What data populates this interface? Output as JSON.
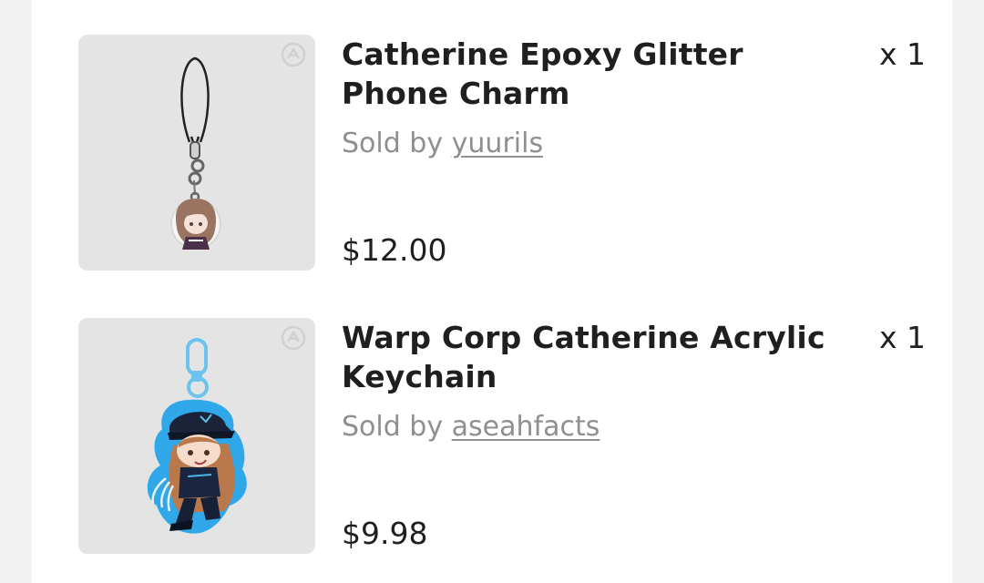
{
  "cart": {
    "items": [
      {
        "title": "Catherine Epoxy Glitter Phone Charm",
        "quantity": "x 1",
        "sold_by_prefix": "Sold by",
        "seller": "yuurils",
        "price": "$12.00",
        "image_icon": "phone-charm-image"
      },
      {
        "title": "Warp Corp Catherine Acrylic Keychain",
        "quantity": "x 1",
        "sold_by_prefix": "Sold by",
        "seller": "aseahfacts",
        "price": "$9.98",
        "image_icon": "acrylic-keychain-image"
      }
    ]
  },
  "colors": {
    "page_bg": "#f2f2f2",
    "panel_bg": "#ffffff",
    "thumb_bg": "#e4e4e4",
    "text": "#1f1f1f",
    "muted": "#8f8f8f",
    "keychain_outline": "#3aa9e6"
  }
}
